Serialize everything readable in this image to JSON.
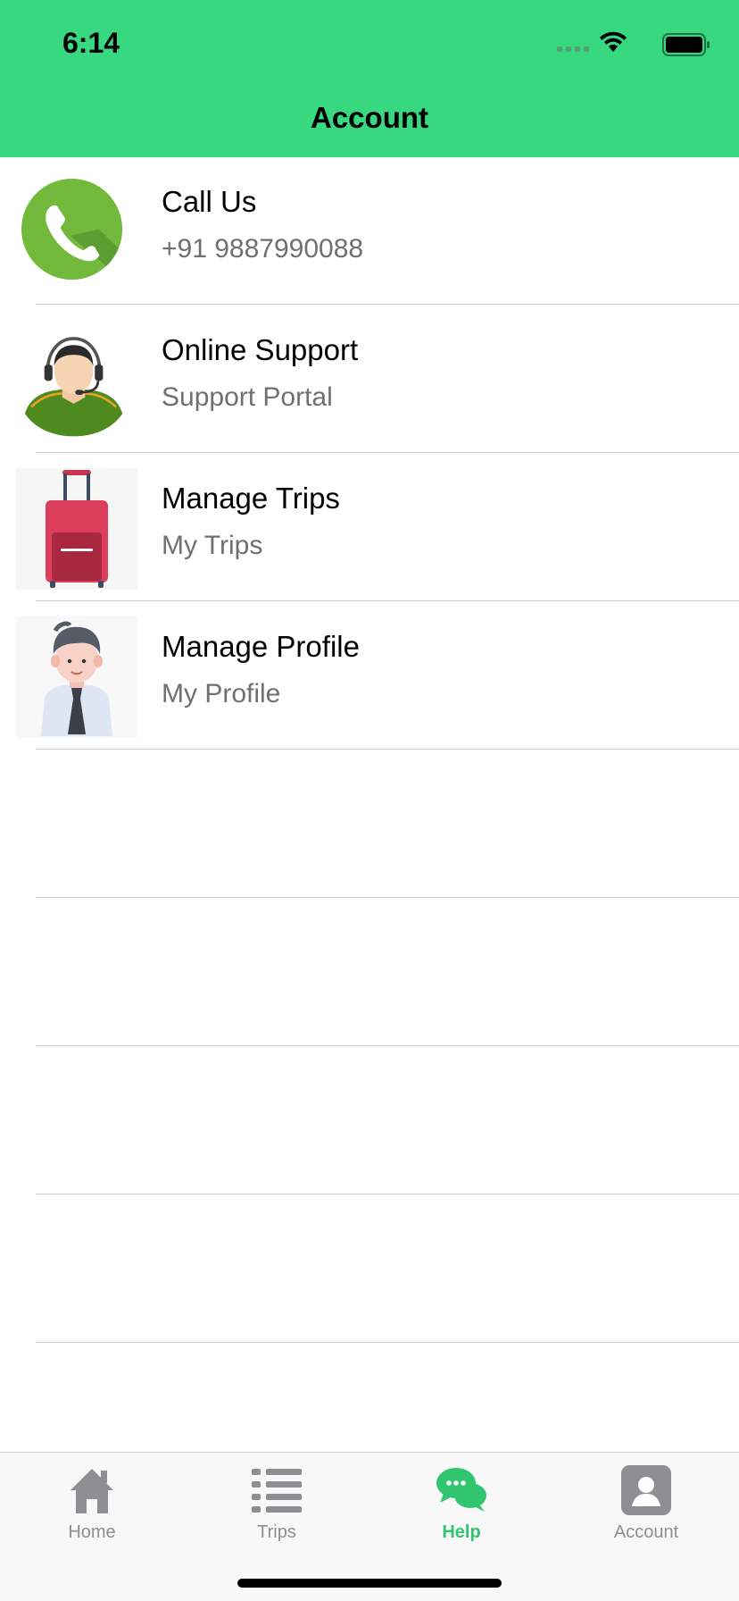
{
  "status_bar": {
    "time": "6:14"
  },
  "header": {
    "title": "Account"
  },
  "rows": [
    {
      "title": "Call Us",
      "subtitle": "+91 9887990088"
    },
    {
      "title": "Online Support",
      "subtitle": "Support Portal"
    },
    {
      "title": "Manage Trips",
      "subtitle": "My Trips"
    },
    {
      "title": "Manage Profile",
      "subtitle": "My Profile"
    }
  ],
  "tabbar": {
    "items": [
      {
        "label": "Home",
        "icon": "home-icon"
      },
      {
        "label": "Trips",
        "icon": "list-icon"
      },
      {
        "label": "Help",
        "icon": "chat-bubbles-icon",
        "active": true
      },
      {
        "label": "Account",
        "icon": "account-icon"
      }
    ]
  },
  "colors": {
    "header_bg": "#37d87f",
    "active_tab": "#2fc66f",
    "inactive_tab": "#8e8e93"
  }
}
